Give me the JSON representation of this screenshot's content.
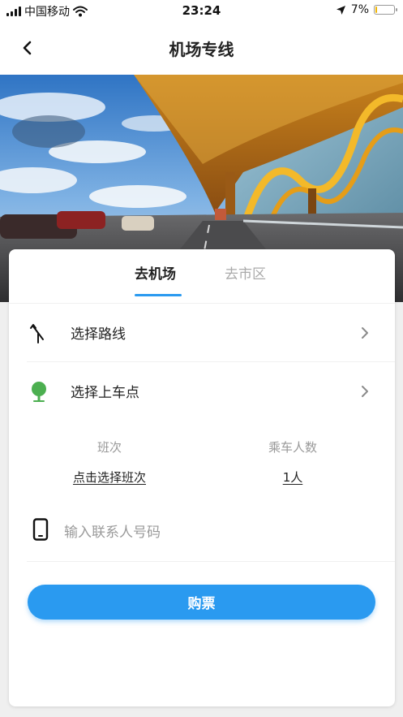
{
  "status_bar": {
    "carrier": "中国移动",
    "time": "23:24",
    "battery_percent": "7%",
    "battery_level": 0.07,
    "icons": [
      "signal-icon",
      "wifi-icon",
      "location-arrow-icon",
      "battery-icon"
    ]
  },
  "nav": {
    "title": "机场专线",
    "back_icon": "chevron-left-icon"
  },
  "tabs": [
    {
      "label": "去机场",
      "active": true
    },
    {
      "label": "去市区",
      "active": false
    }
  ],
  "rows": {
    "route": {
      "label": "选择路线",
      "icon": "route-merge-icon"
    },
    "pickup": {
      "label": "选择上车点",
      "icon": "tree-pin-icon"
    }
  },
  "schedule": {
    "header": "班次",
    "value": "点击选择班次"
  },
  "passengers": {
    "header": "乘车人数",
    "value": "1人"
  },
  "contact": {
    "placeholder": "输入联系人号码",
    "value": "",
    "icon": "phone-icon"
  },
  "buy_button": {
    "label": "购票"
  },
  "colors": {
    "accent": "#2a9af0",
    "pin_green": "#4caf50",
    "battery_low": "#f0b400"
  }
}
